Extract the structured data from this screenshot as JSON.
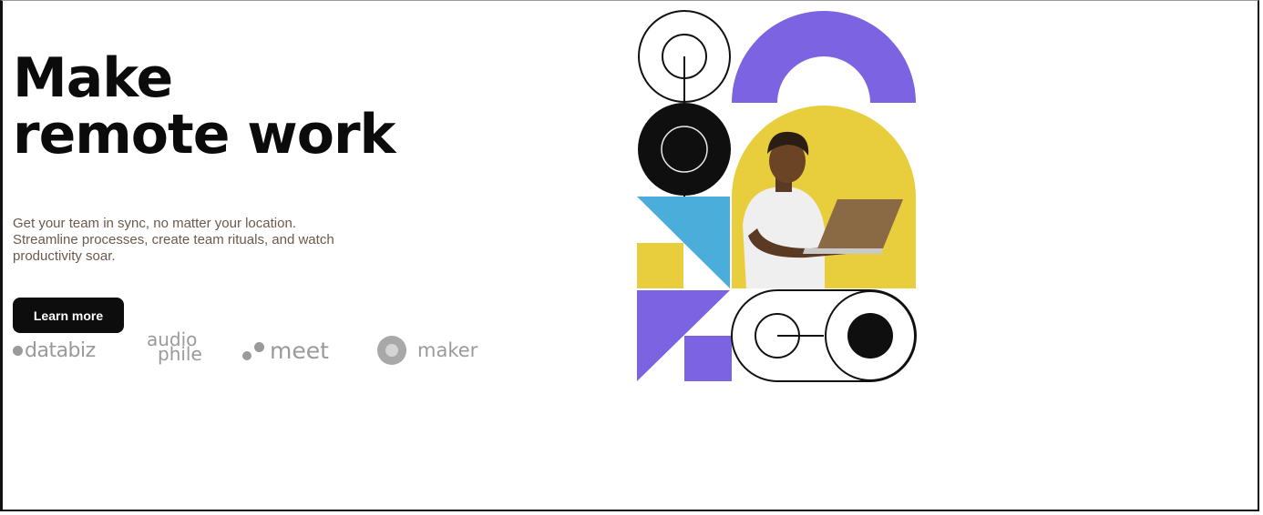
{
  "hero": {
    "title_line1": "Make",
    "title_line2": "remote work",
    "description": "Get your team in sync, no matter your location. Streamline processes, create team rituals, and watch productivity soar.",
    "cta_label": "Learn more"
  },
  "clients": {
    "databiz": "databiz",
    "audiophile_line1": "audio",
    "audiophile_line2": "phile",
    "meet": "meet",
    "maker": "maker"
  },
  "colors": {
    "text_dark": "#0b0b0b",
    "text_body": "#6b5a4c",
    "purple": "#7b63e1",
    "yellow": "#e8ce3d",
    "blue": "#4badd9",
    "logo_gray": "#9a9a9a"
  },
  "icons": [
    "circle-dot-icon",
    "dark-circle-icon",
    "arch-shape",
    "triangle-shape",
    "toggle-shape"
  ]
}
